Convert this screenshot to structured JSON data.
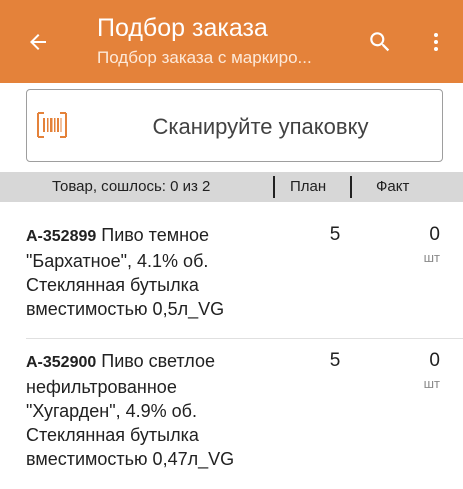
{
  "appbar": {
    "title": "Подбор заказа",
    "subtitle": "Подбор заказа с маркиро...",
    "back_icon": "arrow-left-icon",
    "search_icon": "search-icon",
    "menu_icon": "more-vert-icon",
    "color": "#e4823a"
  },
  "scan": {
    "icon": "barcode-icon",
    "text": "Сканируйте упаковку",
    "icon_color": "#e4823a"
  },
  "table": {
    "header": {
      "goods": "Товар, сошлось: 0 из 2",
      "plan": "План",
      "fact": "Факт"
    },
    "rows": [
      {
        "code": "А-352899",
        "name_lines": [
          "Пиво темное",
          "\"Бархатное\", 4.1% об.",
          "Стеклянная бутылка",
          "вместимостью 0,5л_VG"
        ],
        "plan": "5",
        "fact": "0",
        "unit": "шт"
      },
      {
        "code": "А-352900",
        "name_lines": [
          "Пиво светлое",
          "нефильтрованное",
          "\"Хугарден\", 4.9% об.",
          "Стеклянная бутылка",
          "вместимостью 0,47л_VG"
        ],
        "plan": "5",
        "fact": "0",
        "unit": "шт"
      }
    ]
  }
}
